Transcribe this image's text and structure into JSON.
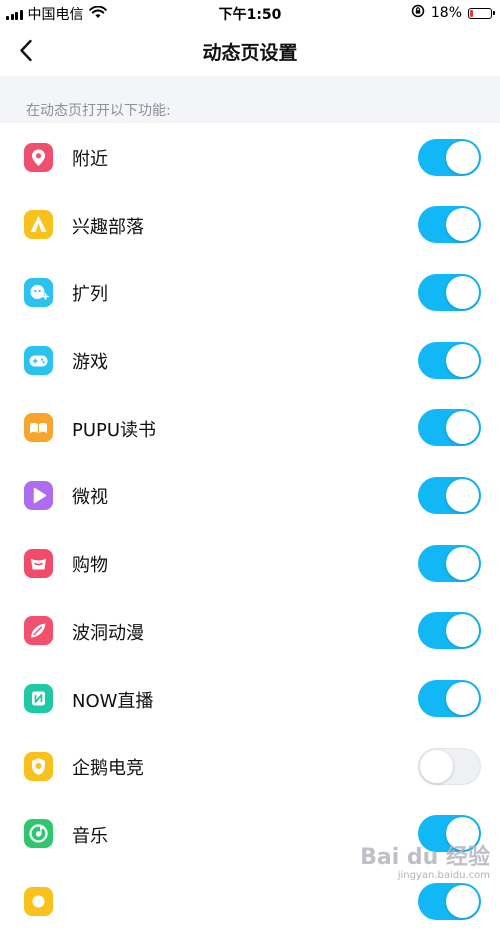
{
  "status_bar": {
    "carrier": "中国电信",
    "time": "下午1:50",
    "battery": "18%",
    "battery_level": 0.18,
    "icons": [
      "signal-icon",
      "wifi-icon",
      "orientation-lock-icon",
      "battery-icon"
    ]
  },
  "nav": {
    "title": "动态页设置",
    "back_icon": "chevron-left-icon"
  },
  "section": {
    "header": "在动态页打开以下功能:"
  },
  "items": [
    {
      "label": "附近",
      "icon": "location-pin-icon",
      "color": "#f0506e",
      "on": true
    },
    {
      "label": "兴趣部落",
      "icon": "tent-icon",
      "color": "#f9c11c",
      "on": true
    },
    {
      "label": "扩列",
      "icon": "add-friend-icon",
      "color": "#2ac3f0",
      "on": true
    },
    {
      "label": "游戏",
      "icon": "gamepad-icon",
      "color": "#2ac3f0",
      "on": true
    },
    {
      "label": "PUPU读书",
      "icon": "book-icon",
      "color": "#f7a52b",
      "on": true
    },
    {
      "label": "微视",
      "icon": "video-play-icon",
      "color": "#b06cf0",
      "on": true
    },
    {
      "label": "购物",
      "icon": "shopping-icon",
      "color": "#f04c6a",
      "on": true
    },
    {
      "label": "波洞动漫",
      "icon": "comic-icon",
      "color": "#f2506e",
      "on": true
    },
    {
      "label": "NOW直播",
      "icon": "live-stream-icon",
      "color": "#1fc9a6",
      "on": true
    },
    {
      "label": "企鹅电竞",
      "icon": "esports-icon",
      "color": "#f9c11c",
      "on": false
    },
    {
      "label": "音乐",
      "icon": "music-icon",
      "color": "#2fc76e",
      "on": true
    },
    {
      "label": "",
      "icon": "app-icon",
      "color": "#f9c11c",
      "on": true
    }
  ],
  "colors": {
    "toggle_on": "#12b7f5",
    "toggle_off": "#eff0f4",
    "section_bg": "#f4f5f9"
  },
  "watermark": {
    "brand": "Bai du 经验",
    "url": "jingyan.baidu.com"
  }
}
